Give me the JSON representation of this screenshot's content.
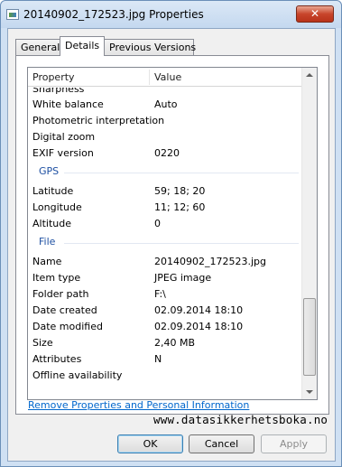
{
  "window": {
    "title": "20140902_172523.jpg Properties",
    "close_label": "✕"
  },
  "tabs": [
    {
      "label": "General"
    },
    {
      "label": "Details"
    },
    {
      "label": "Previous Versions"
    }
  ],
  "columns": {
    "property": "Property",
    "value": "Value"
  },
  "rows": {
    "r0": {
      "k": "Sharpness",
      "v": ""
    },
    "r1": {
      "k": "White balance",
      "v": "Auto"
    },
    "r2": {
      "k": "Photometric interpretation",
      "v": ""
    },
    "r3": {
      "k": "Digital zoom",
      "v": ""
    },
    "r4": {
      "k": "EXIF version",
      "v": "0220"
    },
    "g_gps": {
      "label": "GPS"
    },
    "r5": {
      "k": "Latitude",
      "v": "59; 18; 20"
    },
    "r6": {
      "k": "Longitude",
      "v": "11; 12; 60"
    },
    "r7": {
      "k": "Altitude",
      "v": "0"
    },
    "g_file": {
      "label": "File"
    },
    "r8": {
      "k": "Name",
      "v": "20140902_172523.jpg"
    },
    "r9": {
      "k": "Item type",
      "v": "JPEG image"
    },
    "r10": {
      "k": "Folder path",
      "v": "F:\\"
    },
    "r11": {
      "k": "Date created",
      "v": "02.09.2014 18:10"
    },
    "r12": {
      "k": "Date modified",
      "v": "02.09.2014 18:10"
    },
    "r13": {
      "k": "Size",
      "v": "2,40 MB"
    },
    "r14": {
      "k": "Attributes",
      "v": "N"
    },
    "r15": {
      "k": "Offline availability",
      "v": ""
    }
  },
  "links": {
    "remove": "Remove Properties and Personal Information"
  },
  "watermark": "www.datasikkerhetsboka.no",
  "buttons": {
    "ok": "OK",
    "cancel": "Cancel",
    "apply": "Apply"
  }
}
